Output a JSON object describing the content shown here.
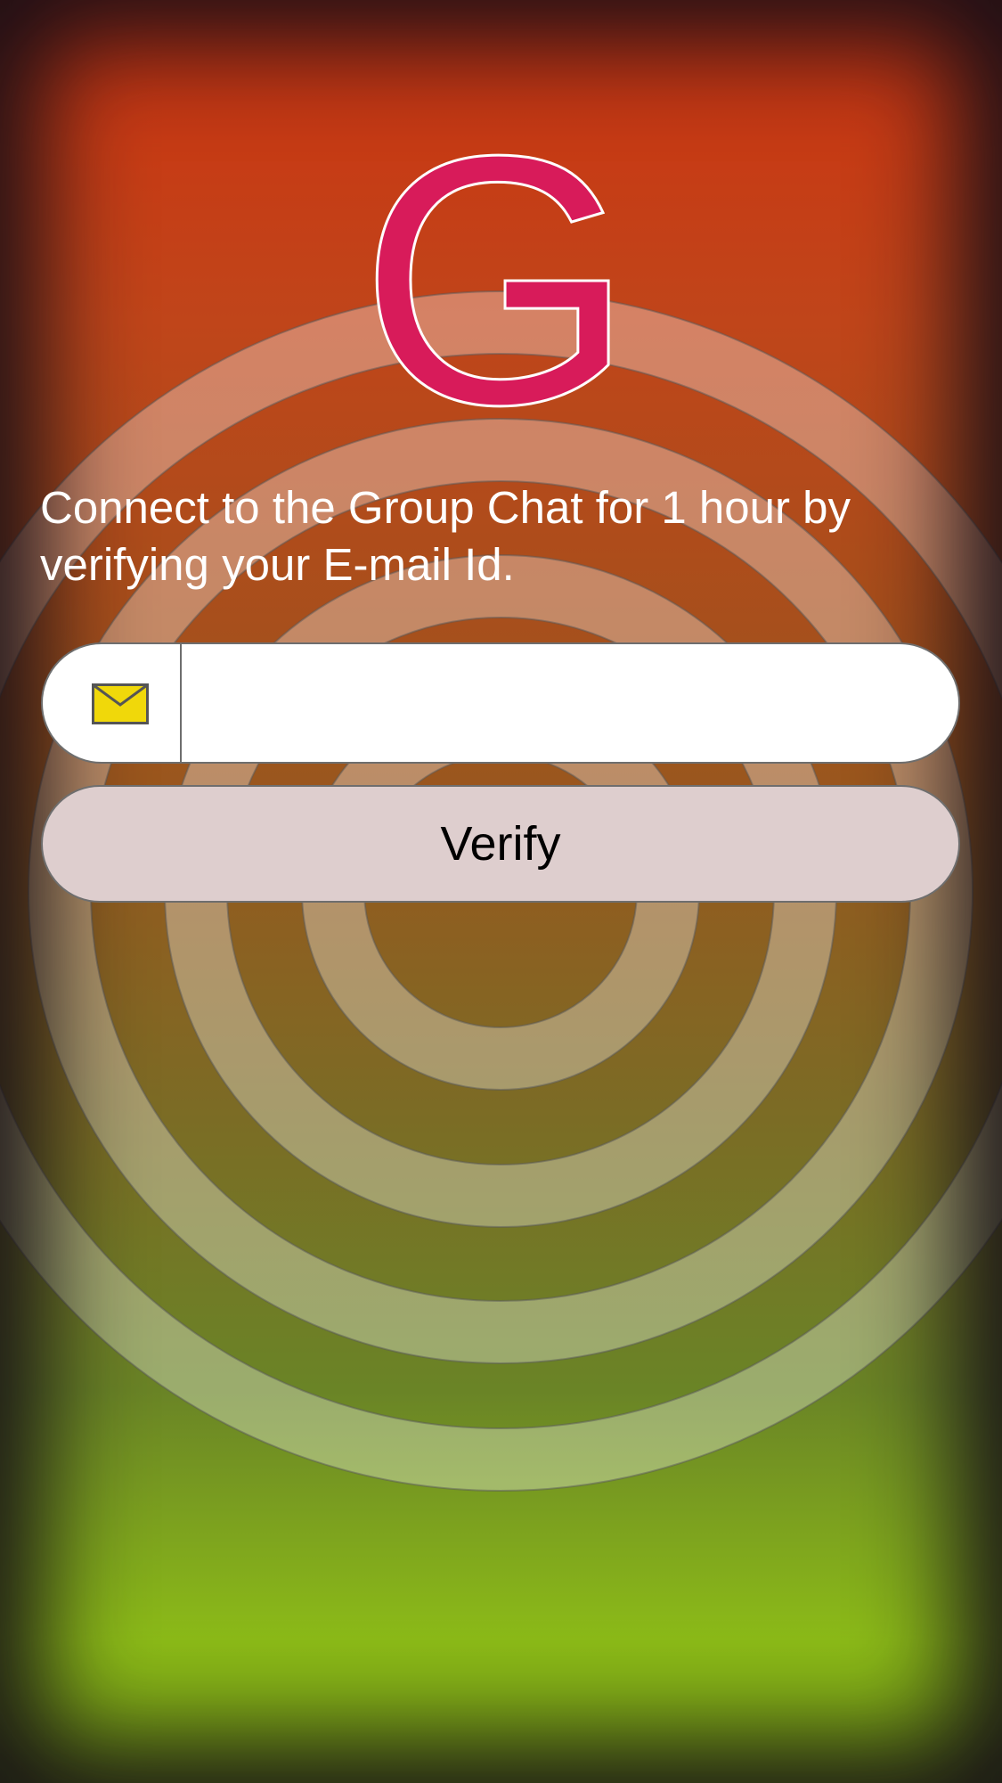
{
  "logo": {
    "letter": "G",
    "color": "#d81b5a"
  },
  "message": {
    "text": "Connect to the Group Chat for 1 hour by verifying your E-mail Id."
  },
  "email": {
    "icon": "envelope-icon",
    "icon_color": "#f0d80a",
    "value": "",
    "placeholder": ""
  },
  "verify": {
    "label": "Verify"
  },
  "colors": {
    "top": "#cc3311",
    "bottom": "#8cbb18",
    "rings": "#ffffff"
  }
}
